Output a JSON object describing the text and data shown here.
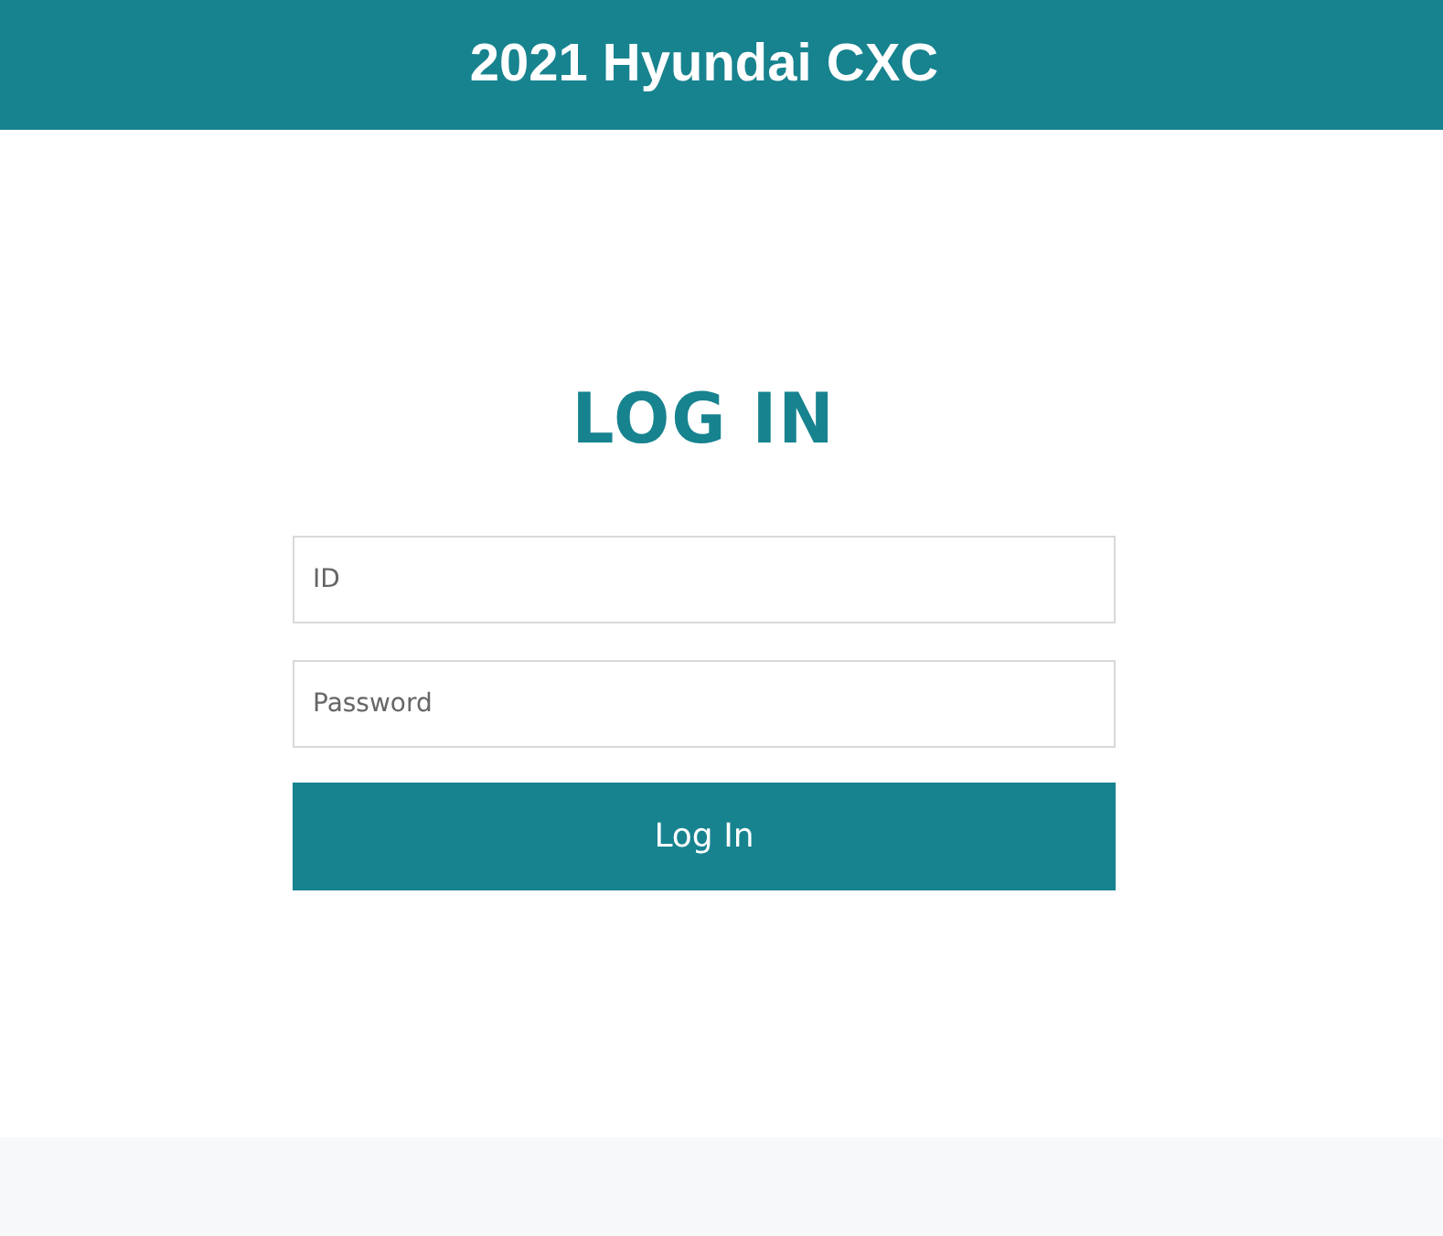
{
  "header": {
    "title": "2021 Hyundai CXC"
  },
  "login": {
    "heading": "LOG IN",
    "fields": [
      {
        "placeholder": "ID"
      },
      {
        "placeholder": "Password"
      }
    ],
    "button": "Log In"
  }
}
